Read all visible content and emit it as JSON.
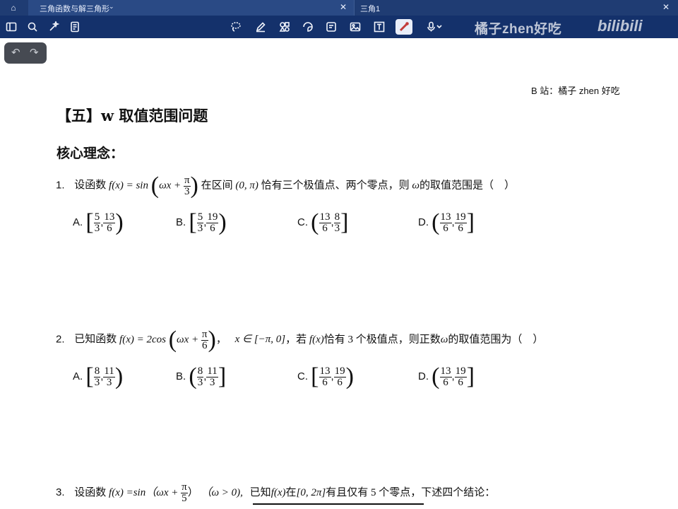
{
  "tabs": {
    "home_icon": "home-icon",
    "active": {
      "label": "三角函数与解三角形",
      "chev": "⌄",
      "close": "✕"
    },
    "other": {
      "label": "三角1",
      "close": "✕"
    }
  },
  "toolbar": {
    "left_icons": [
      "sidebar-icon",
      "search-icon",
      "magic-icon",
      "pages-icon"
    ],
    "center_icons": [
      "lasso-icon",
      "pen-icon",
      "shapes-icon",
      "sticker-icon",
      "text-note-icon",
      "image-icon",
      "textbox-icon",
      "laser-pointer-icon",
      "mic-icon"
    ],
    "watermark": "橘子zhen好吃",
    "logo": "bilibili"
  },
  "undo": {
    "undo": "↶",
    "redo": "↷"
  },
  "doc": {
    "credit": "B 站：橘子 zhen 好吃",
    "section_title": "【五】w 取值范围问题",
    "core_label": "核心理念：",
    "q1": {
      "num": "1.",
      "text_a": "设函数",
      "func": "f(x) = sin",
      "inner": "ωx + ",
      "frac": [
        "π",
        "3"
      ],
      "text_b": "在区间",
      "interval": "(0, π)",
      "text_c": "恰有三个极值点、两个零点，则",
      "omega": "ω",
      "text_d": "的取值范围是（　）",
      "options": [
        {
          "label": "A.",
          "open": "[",
          "a": [
            "5",
            "3"
          ],
          "b": [
            "13",
            "6"
          ],
          "close": ")"
        },
        {
          "label": "B.",
          "open": "[",
          "a": [
            "5",
            "3"
          ],
          "b": [
            "19",
            "6"
          ],
          "close": ")"
        },
        {
          "label": "C.",
          "open": "(",
          "a": [
            "13",
            "6"
          ],
          "b": [
            "8",
            "3"
          ],
          "close": "]"
        },
        {
          "label": "D.",
          "open": "(",
          "a": [
            "13",
            "6"
          ],
          "b": [
            "19",
            "6"
          ],
          "close": "]"
        }
      ]
    },
    "q2": {
      "num": "2.",
      "text_a": "已知函数",
      "func": "f(x) = 2cos",
      "inner": "ωx + ",
      "frac": [
        "π",
        "6"
      ],
      "comma": "，",
      "domain": "x ∈ [−π, 0]",
      "text_b": "，若",
      "fx": "f(x)",
      "text_c": "恰有 3 个极值点，则正数",
      "omega": "ω",
      "text_d": "的取值范围为（　）",
      "options": [
        {
          "label": "A.",
          "open": "[",
          "a": [
            "8",
            "3"
          ],
          "b": [
            "11",
            "3"
          ],
          "close": ")"
        },
        {
          "label": "B.",
          "open": "(",
          "a": [
            "8",
            "3"
          ],
          "b": [
            "11",
            "3"
          ],
          "close": "]"
        },
        {
          "label": "C.",
          "open": "[",
          "a": [
            "13",
            "6"
          ],
          "b": [
            "19",
            "6"
          ],
          "close": ")"
        },
        {
          "label": "D.",
          "open": "(",
          "a": [
            "13",
            "6"
          ],
          "b": [
            "19",
            "6"
          ],
          "close": "]"
        }
      ]
    },
    "q3": {
      "num": "3.",
      "text_a": "设函数",
      "func": "f(x) =sin",
      "inner": "（ωx + ",
      "frac": [
        "π",
        "5"
      ],
      "inner_close": "）",
      "cond": "（ω > 0),",
      "text_b": "已知",
      "fx": "f(x)",
      "text_c": "在",
      "interval": "[0, 2π]",
      "text_d": "有且仅有 5 个零点，下述四个结论："
    }
  }
}
